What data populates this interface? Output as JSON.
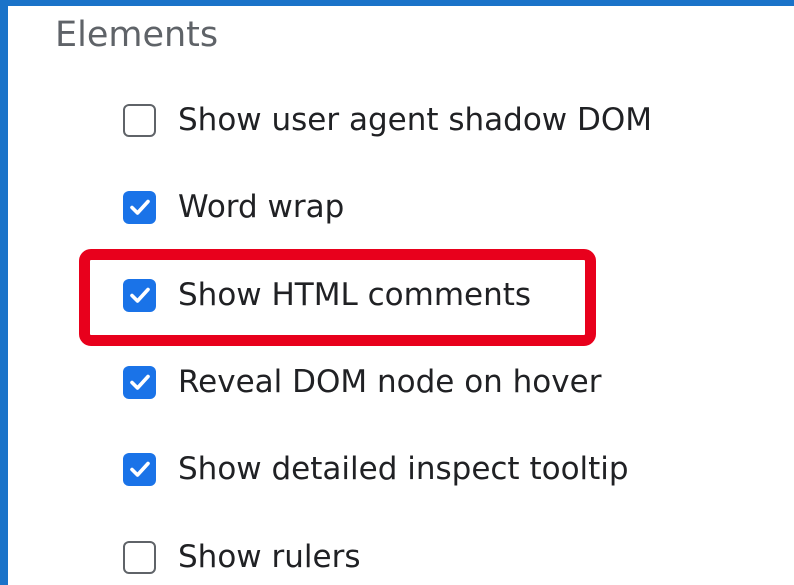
{
  "section": {
    "title": "Elements"
  },
  "options": [
    {
      "label": "Show user agent shadow DOM",
      "checked": false
    },
    {
      "label": "Word wrap",
      "checked": true
    },
    {
      "label": "Show HTML comments",
      "checked": true,
      "highlighted": true
    },
    {
      "label": "Reveal DOM node on hover",
      "checked": true
    },
    {
      "label": "Show detailed inspect tooltip",
      "checked": true
    },
    {
      "label": "Show rulers",
      "checked": false
    }
  ],
  "colors": {
    "window_border": "#1a73c9",
    "checkbox_checked": "#1a73e8",
    "checkbox_unchecked_border": "#5f6368",
    "highlight": "#e8001c",
    "title_text": "#5f6368",
    "label_text": "#202124"
  },
  "icons": {
    "checked": "checkmark-icon"
  }
}
